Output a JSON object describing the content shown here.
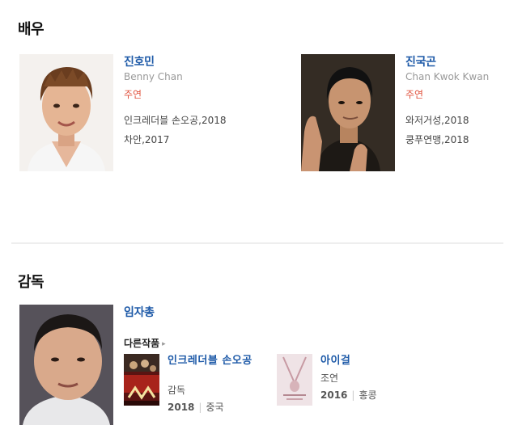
{
  "cast": {
    "title": "배우",
    "actors": [
      {
        "name": "진호민",
        "english_name": "Benny Chan",
        "role": "주연",
        "works": [
          "인크레더블 손오공,2018",
          "차안,2017"
        ]
      },
      {
        "name": "진국곤",
        "english_name": "Chan Kwok Kwan",
        "role": "주연",
        "works": [
          "와저거성,2018",
          "쿵푸연맹,2018"
        ]
      }
    ]
  },
  "director": {
    "title": "감독",
    "name": "임자총",
    "other_works_label": "다른작품",
    "films": [
      {
        "title": "인크레더블 손오공",
        "role": "감독",
        "year": "2018",
        "country": "중국"
      },
      {
        "title": "아이걸",
        "role": "조연",
        "year": "2016",
        "country": "홍콩"
      }
    ]
  }
}
